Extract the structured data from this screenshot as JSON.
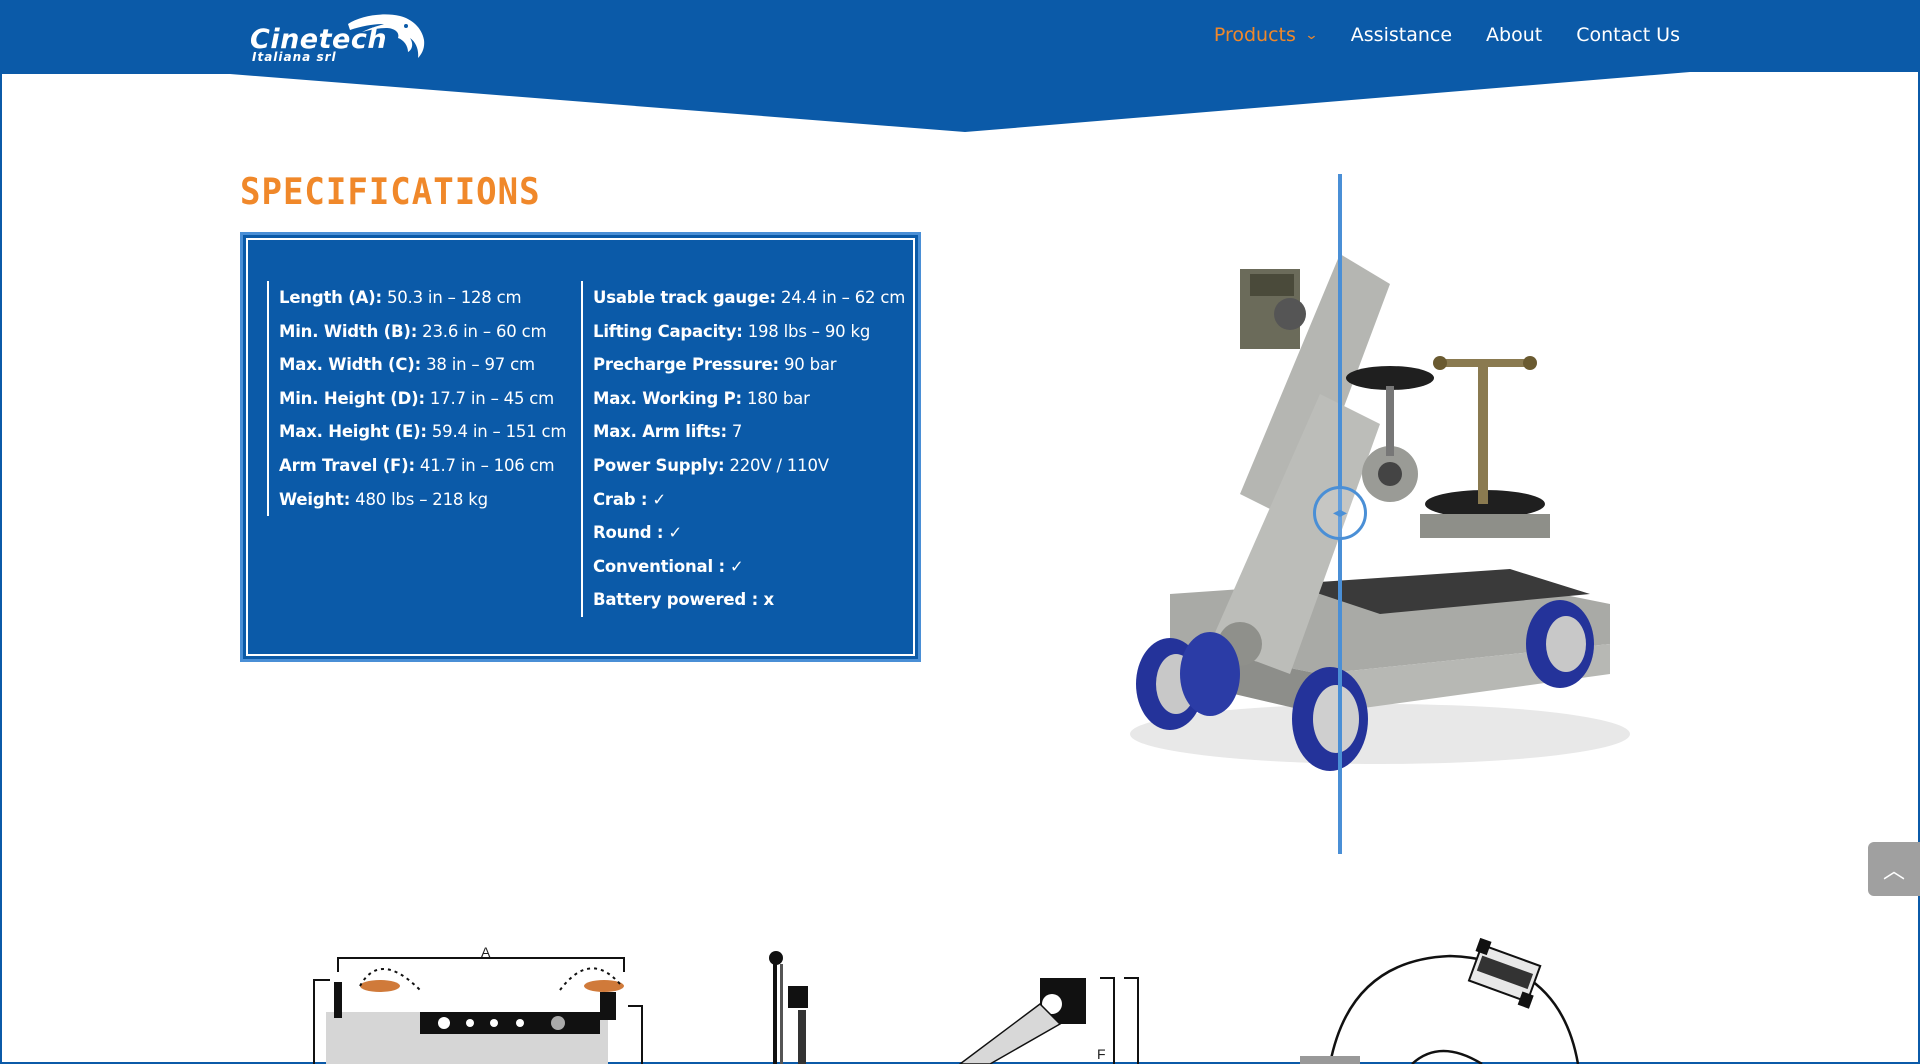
{
  "brand": {
    "name": "Cinetech",
    "subtitle": "Italiana srl"
  },
  "nav": {
    "items": [
      {
        "label": "Products",
        "active": true,
        "has_dropdown": true
      },
      {
        "label": "Assistance"
      },
      {
        "label": "About"
      },
      {
        "label": "Contact Us"
      }
    ]
  },
  "specs": {
    "title": "SPECIFICATIONS",
    "left": [
      {
        "key": "Length (A):",
        "value": " 50.3 in – 128 cm"
      },
      {
        "key": "Min. Width (B):",
        "value": " 23.6 in – 60 cm"
      },
      {
        "key": "Max. Width (C):",
        "value": " 38 in – 97 cm"
      },
      {
        "key": "Min. Height (D):",
        "value": " 17.7 in – 45 cm"
      },
      {
        "key": "Max. Height (E):",
        "value": " 59.4 in – 151 cm"
      },
      {
        "key": "Arm Travel (F):",
        "value": " 41.7 in – 106 cm"
      },
      {
        "key": "Weight:",
        "value": " 480 lbs – 218 kg"
      }
    ],
    "right": [
      {
        "key": "Usable track gauge:",
        "value": " 24.4 in – 62 cm"
      },
      {
        "key": "Lifting Capacity:",
        "value": " 198 lbs – 90 kg"
      },
      {
        "key": "Precharge Pressure:",
        "value": " 90 bar"
      },
      {
        "key": "Max. Working P:",
        "value": " 180 bar"
      },
      {
        "key": "Max. Arm lifts:",
        "value": " 7"
      },
      {
        "key": "Power Supply:",
        "value": " 220V / 110V"
      },
      {
        "key": "Crab :",
        "value": " ✓"
      },
      {
        "key": "Round :",
        "value": " ✓"
      },
      {
        "key": "Conventional :",
        "value": " ✓"
      },
      {
        "key": "Battery powered : x",
        "value": ""
      }
    ]
  },
  "diagrams": {
    "label_a": "A",
    "label_f": "F"
  },
  "colors": {
    "primary": "#0b5aa8",
    "accent": "#f0882a",
    "slider": "#4a8fd6"
  },
  "icons": {
    "scroll_top": "chevron-up-icon",
    "dropdown": "chevron-down-icon"
  }
}
